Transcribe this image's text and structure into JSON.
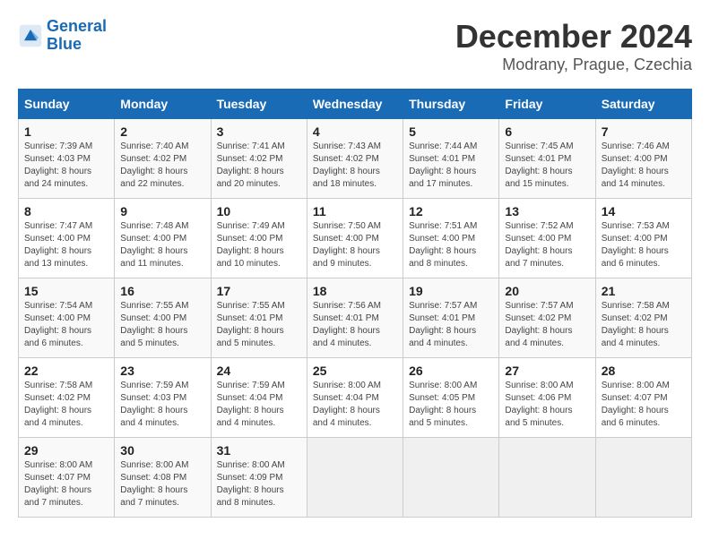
{
  "logo": {
    "text_general": "General",
    "text_blue": "Blue"
  },
  "title": "December 2024",
  "subtitle": "Modrany, Prague, Czechia",
  "header": {
    "days": [
      "Sunday",
      "Monday",
      "Tuesday",
      "Wednesday",
      "Thursday",
      "Friday",
      "Saturday"
    ]
  },
  "weeks": [
    [
      {
        "day": "1",
        "sunrise": "7:39 AM",
        "sunset": "4:03 PM",
        "daylight": "8 hours and 24 minutes."
      },
      {
        "day": "2",
        "sunrise": "7:40 AM",
        "sunset": "4:02 PM",
        "daylight": "8 hours and 22 minutes."
      },
      {
        "day": "3",
        "sunrise": "7:41 AM",
        "sunset": "4:02 PM",
        "daylight": "8 hours and 20 minutes."
      },
      {
        "day": "4",
        "sunrise": "7:43 AM",
        "sunset": "4:02 PM",
        "daylight": "8 hours and 18 minutes."
      },
      {
        "day": "5",
        "sunrise": "7:44 AM",
        "sunset": "4:01 PM",
        "daylight": "8 hours and 17 minutes."
      },
      {
        "day": "6",
        "sunrise": "7:45 AM",
        "sunset": "4:01 PM",
        "daylight": "8 hours and 15 minutes."
      },
      {
        "day": "7",
        "sunrise": "7:46 AM",
        "sunset": "4:00 PM",
        "daylight": "8 hours and 14 minutes."
      }
    ],
    [
      {
        "day": "8",
        "sunrise": "7:47 AM",
        "sunset": "4:00 PM",
        "daylight": "8 hours and 13 minutes."
      },
      {
        "day": "9",
        "sunrise": "7:48 AM",
        "sunset": "4:00 PM",
        "daylight": "8 hours and 11 minutes."
      },
      {
        "day": "10",
        "sunrise": "7:49 AM",
        "sunset": "4:00 PM",
        "daylight": "8 hours and 10 minutes."
      },
      {
        "day": "11",
        "sunrise": "7:50 AM",
        "sunset": "4:00 PM",
        "daylight": "8 hours and 9 minutes."
      },
      {
        "day": "12",
        "sunrise": "7:51 AM",
        "sunset": "4:00 PM",
        "daylight": "8 hours and 8 minutes."
      },
      {
        "day": "13",
        "sunrise": "7:52 AM",
        "sunset": "4:00 PM",
        "daylight": "8 hours and 7 minutes."
      },
      {
        "day": "14",
        "sunrise": "7:53 AM",
        "sunset": "4:00 PM",
        "daylight": "8 hours and 6 minutes."
      }
    ],
    [
      {
        "day": "15",
        "sunrise": "7:54 AM",
        "sunset": "4:00 PM",
        "daylight": "8 hours and 6 minutes."
      },
      {
        "day": "16",
        "sunrise": "7:55 AM",
        "sunset": "4:00 PM",
        "daylight": "8 hours and 5 minutes."
      },
      {
        "day": "17",
        "sunrise": "7:55 AM",
        "sunset": "4:01 PM",
        "daylight": "8 hours and 5 minutes."
      },
      {
        "day": "18",
        "sunrise": "7:56 AM",
        "sunset": "4:01 PM",
        "daylight": "8 hours and 4 minutes."
      },
      {
        "day": "19",
        "sunrise": "7:57 AM",
        "sunset": "4:01 PM",
        "daylight": "8 hours and 4 minutes."
      },
      {
        "day": "20",
        "sunrise": "7:57 AM",
        "sunset": "4:02 PM",
        "daylight": "8 hours and 4 minutes."
      },
      {
        "day": "21",
        "sunrise": "7:58 AM",
        "sunset": "4:02 PM",
        "daylight": "8 hours and 4 minutes."
      }
    ],
    [
      {
        "day": "22",
        "sunrise": "7:58 AM",
        "sunset": "4:02 PM",
        "daylight": "8 hours and 4 minutes."
      },
      {
        "day": "23",
        "sunrise": "7:59 AM",
        "sunset": "4:03 PM",
        "daylight": "8 hours and 4 minutes."
      },
      {
        "day": "24",
        "sunrise": "7:59 AM",
        "sunset": "4:04 PM",
        "daylight": "8 hours and 4 minutes."
      },
      {
        "day": "25",
        "sunrise": "8:00 AM",
        "sunset": "4:04 PM",
        "daylight": "8 hours and 4 minutes."
      },
      {
        "day": "26",
        "sunrise": "8:00 AM",
        "sunset": "4:05 PM",
        "daylight": "8 hours and 5 minutes."
      },
      {
        "day": "27",
        "sunrise": "8:00 AM",
        "sunset": "4:06 PM",
        "daylight": "8 hours and 5 minutes."
      },
      {
        "day": "28",
        "sunrise": "8:00 AM",
        "sunset": "4:07 PM",
        "daylight": "8 hours and 6 minutes."
      }
    ],
    [
      {
        "day": "29",
        "sunrise": "8:00 AM",
        "sunset": "4:07 PM",
        "daylight": "8 hours and 7 minutes."
      },
      {
        "day": "30",
        "sunrise": "8:00 AM",
        "sunset": "4:08 PM",
        "daylight": "8 hours and 7 minutes."
      },
      {
        "day": "31",
        "sunrise": "8:00 AM",
        "sunset": "4:09 PM",
        "daylight": "8 hours and 8 minutes."
      },
      null,
      null,
      null,
      null
    ]
  ],
  "labels": {
    "sunrise": "Sunrise: ",
    "sunset": "Sunset: ",
    "daylight": "Daylight: "
  }
}
